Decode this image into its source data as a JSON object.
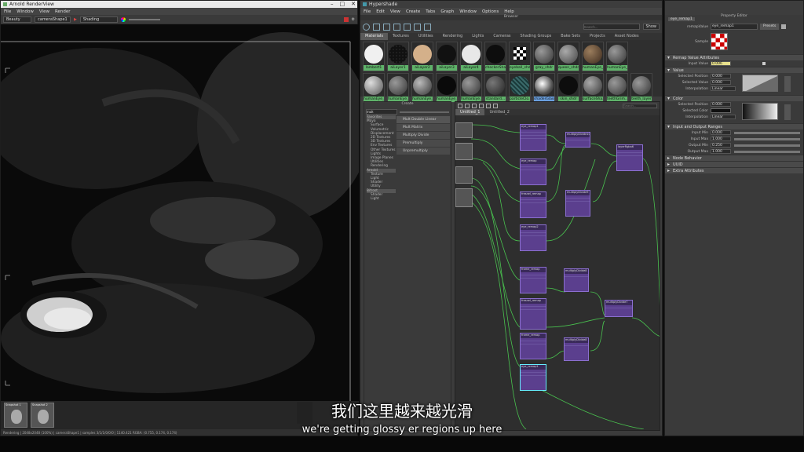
{
  "render_view": {
    "title": "Arnold RenderView",
    "menu": [
      "File",
      "Window",
      "View",
      "Render"
    ],
    "toolbar": {
      "display": "Beauty",
      "camera": "cameraShape1",
      "mode": "Shading"
    },
    "snapshots": [
      "Snapshot 1",
      "Snapshot 2"
    ],
    "status": "Rendering | 2048x2048 (100%) | cameraShape1 | samples 3/1/1/0/0/0 | 1140.421 RGBA: (0.755, 0.174, 0.174)"
  },
  "hypershade": {
    "title": "Hypershade",
    "menu": [
      "File",
      "Edit",
      "View",
      "Create",
      "Tabs",
      "Graph",
      "Window",
      "Options",
      "Help"
    ],
    "browser_title": "Browser",
    "search_placeholder": "Search...",
    "show_label": "Show",
    "tabs": [
      "Materials",
      "Textures",
      "Utilities",
      "Rendering",
      "Lights",
      "Cameras",
      "Shading Groups",
      "Bake Sets",
      "Projects",
      "Asset Nodes"
    ],
    "materials_row1": [
      "lambert1",
      "aiLayer1",
      "aiLayer2",
      "aiLayer3",
      "aiLayer4",
      "checkerShader",
      "eyeball_shdr",
      "gray_shdr",
      "queen_shdr",
      "humanEye_...",
      "humanEye_..."
    ],
    "materials_row2": [
      "humanEye_...",
      "humanEye_...",
      "humanEye_...",
      "humanEye_...",
      "humanEye_...",
      "standard...",
      "particleClo...",
      "shaderGlass1",
      "skin_shdr",
      "surfaceSha...",
      "teethGrim...",
      "teeth_layer"
    ],
    "create": {
      "title": "Create",
      "search_value": "mult",
      "tree": [
        "Favorites",
        "Maya",
        "Surface",
        "Volumetric",
        "Displacement",
        "2D Textures",
        "3D Textures",
        "Env Textures",
        "Other Textures",
        "Lights",
        "Image Planes",
        "Utilities",
        "Rendering",
        "Arnold",
        "Texture",
        "Light",
        "Shader",
        "Utility",
        "Bifrost",
        "Shader",
        "Light"
      ],
      "results": [
        "Mult Double Linear",
        "Mult Matrix",
        "Multiply Divide",
        "Premultiply",
        "Unpremultiply"
      ]
    },
    "graph_tabs": [
      "Untitled_1",
      "Untitled_2"
    ],
    "graph_search_placeholder": "Search...",
    "nodes": [
      "multiplyDivide10",
      "layerRgba6",
      "multiplyDivide9",
      "multiplyDivide8",
      "multiplyDivide7",
      "eye_remap1",
      "eye_remap",
      "eye_remap2",
      "fresnel_remap",
      "frame_remap"
    ]
  },
  "property_editor": {
    "title": "Property Editor",
    "node_name": "eye_remap1",
    "remap_label": "remapValue",
    "remap_value": "eye_remap1",
    "presets_label": "Presets",
    "sample_label": "Sample",
    "sections": {
      "attributes": "Remap Value Attributes",
      "value": "Value",
      "color": "Color",
      "io": "Input and Output Ranges",
      "node_behavior": "Node Behavior",
      "uuid": "UUID",
      "extra": "Extra Attributes"
    },
    "input_value_label": "Input Value",
    "input_value": "0.006",
    "value_rows": [
      {
        "label": "Selected Position",
        "value": "0.000"
      },
      {
        "label": "Selected Value",
        "value": "0.000"
      },
      {
        "label": "Interpolation",
        "value": "Linear"
      }
    ],
    "color_rows": [
      {
        "label": "Selected Position",
        "value": "0.000"
      },
      {
        "label": "Selected Color",
        "value": ""
      },
      {
        "label": "Interpolation",
        "value": "Linear"
      }
    ],
    "io_rows": [
      {
        "label": "Input Min",
        "value": "0.000"
      },
      {
        "label": "Input Max",
        "value": "1.000"
      },
      {
        "label": "Output Min",
        "value": "0.250"
      },
      {
        "label": "Output Max",
        "value": "1.000"
      }
    ]
  },
  "subtitles": {
    "zh": "我们这里越来越光滑",
    "en": "we're getting glossy er regions up here"
  }
}
